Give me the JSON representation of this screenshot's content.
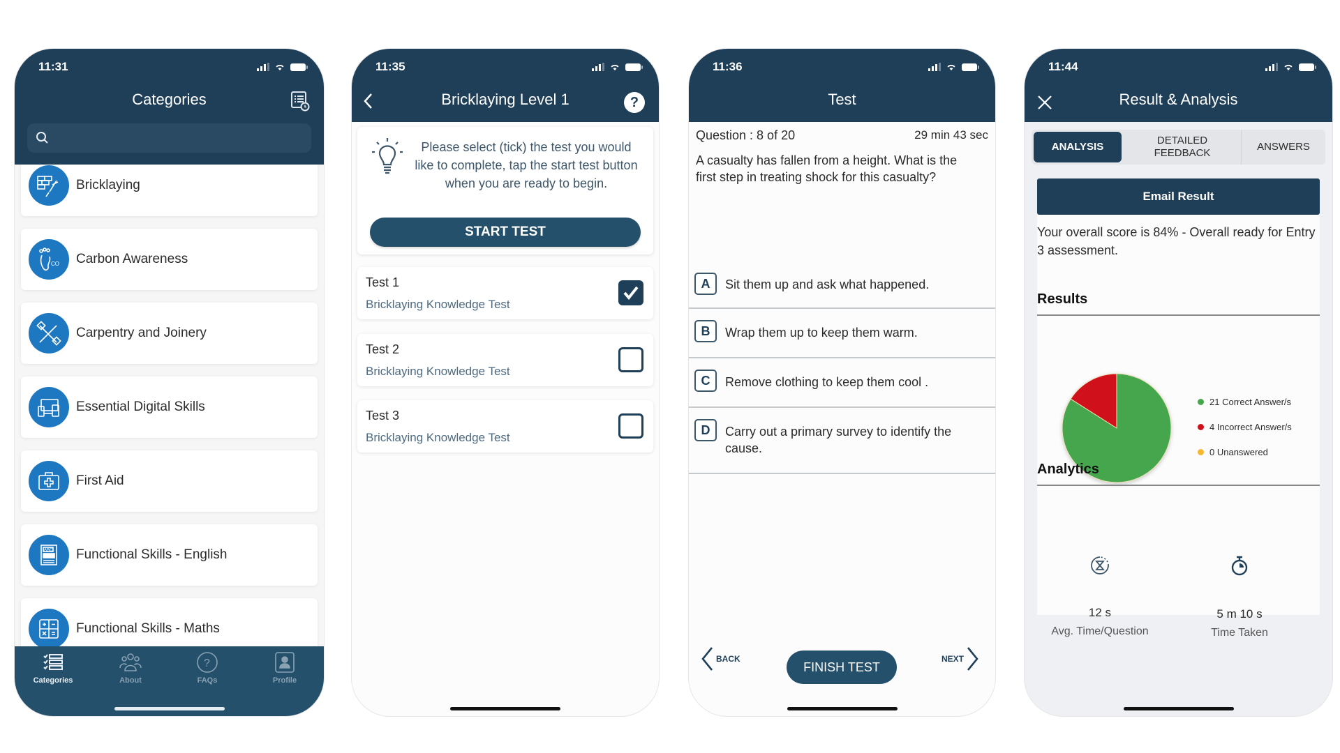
{
  "colors": {
    "navy": "#1f3f59",
    "tabbar": "#24506b",
    "icon_blue": "#1d78c1",
    "correct": "#46a64e",
    "incorrect": "#d0101b",
    "unanswered": "#f5b82e"
  },
  "phone1": {
    "status_time": "11:31",
    "title": "Categories",
    "header_icon": "quiz-history-icon",
    "search": {
      "value": "",
      "placeholder": ""
    },
    "categories": [
      {
        "label": "Bricklaying",
        "icon": "brick-trowel-icon"
      },
      {
        "label": "Carbon Awareness",
        "icon": "footprint-icon"
      },
      {
        "label": "Carpentry and Joinery",
        "icon": "tools-icon"
      },
      {
        "label": "Essential Digital Skills",
        "icon": "devices-icon"
      },
      {
        "label": "First Aid",
        "icon": "first-aid-kit-icon"
      },
      {
        "label": "Functional Skills - English",
        "icon": "abc-book-icon"
      },
      {
        "label": "Functional Skills - Maths",
        "icon": "calculator-icon"
      }
    ],
    "tabs": [
      {
        "label": "Categories",
        "icon": "checklist-icon",
        "active": true
      },
      {
        "label": "About",
        "icon": "group-icon",
        "active": false
      },
      {
        "label": "FAQs",
        "icon": "help-circle-icon",
        "active": false
      },
      {
        "label": "Profile",
        "icon": "profile-icon",
        "active": false
      }
    ]
  },
  "phone2": {
    "status_time": "11:35",
    "title": "Bricklaying Level 1",
    "info_text": "Please select (tick) the test you would like to complete, tap the start test button when you are ready to begin.",
    "start_label": "START TEST",
    "tests": [
      {
        "title": "Test 1",
        "subtitle": "Bricklaying Knowledge Test",
        "checked": true
      },
      {
        "title": "Test 2",
        "subtitle": "Bricklaying Knowledge Test",
        "checked": false
      },
      {
        "title": "Test 3",
        "subtitle": "Bricklaying Knowledge Test",
        "checked": false
      }
    ]
  },
  "phone3": {
    "status_time": "11:36",
    "title": "Test",
    "question_counter": "Question : 8 of 20",
    "timer": "29 min 43 sec",
    "question": "A casualty has fallen from a height. What is the first step in treating shock for this casualty?",
    "options": [
      {
        "letter": "A",
        "text": "Sit them up and ask what happened."
      },
      {
        "letter": "B",
        "text": "Wrap them up to keep them warm."
      },
      {
        "letter": "C",
        "text": "Remove clothing to keep them cool ."
      },
      {
        "letter": "D",
        "text": "Carry out a primary survey to identify the cause."
      }
    ],
    "back_label": "BACK",
    "finish_label": "FINISH TEST",
    "next_label": "NEXT"
  },
  "phone4": {
    "status_time": "11:44",
    "title": "Result & Analysis",
    "segments": [
      "ANALYSIS",
      "DETAILED FEEDBACK",
      "ANSWERS"
    ],
    "active_segment": 0,
    "email_label": "Email Result",
    "score_text": "Your overall score is 84% - Overall ready for Entry 3 assessment.",
    "results_title": "Results",
    "analytics_title": "Analytics",
    "analytics": [
      {
        "value": "12 s",
        "label": "Avg. Time/Question",
        "icon": "hourglass-cycle-icon"
      },
      {
        "value": "5 m 10 s",
        "label": "Time Taken",
        "icon": "stopwatch-icon"
      }
    ]
  },
  "chart_data": {
    "type": "pie",
    "title": "Results",
    "slices": [
      {
        "name": "Correct Answer/s",
        "value": 21,
        "color": "#46a64e",
        "legend": "21 Correct Answer/s"
      },
      {
        "name": "Incorrect Answer/s",
        "value": 4,
        "color": "#d0101b",
        "legend": "4 Incorrect Answer/s"
      },
      {
        "name": "Unanswered",
        "value": 0,
        "color": "#f5b82e",
        "legend": "0 Unanswered"
      }
    ],
    "legend_position": "right"
  }
}
